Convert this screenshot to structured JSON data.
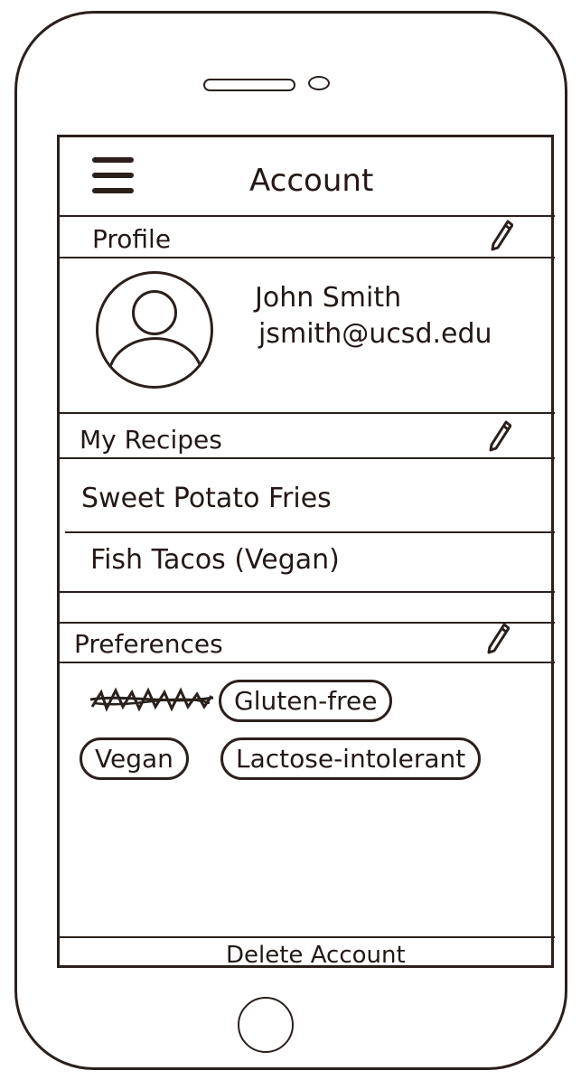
{
  "header": {
    "title": "Account",
    "menu_icon": "hamburger-menu-icon"
  },
  "profile": {
    "section_label": "Profile",
    "edit_icon": "pencil-icon",
    "avatar_icon": "user-avatar-icon",
    "name": "John Smith",
    "email": "jsmith@ucsd.edu"
  },
  "recipes": {
    "section_label": "My Recipes",
    "edit_icon": "pencil-icon",
    "items": [
      {
        "label": "Sweet Potato Fries"
      },
      {
        "label": "Fish Tacos (Vegan)"
      }
    ]
  },
  "preferences": {
    "section_label": "Preferences",
    "edit_icon": "pencil-icon",
    "tags": [
      {
        "label": "Gluten-free"
      },
      {
        "label": "Vegan"
      },
      {
        "label": "Lactose-intolerant"
      }
    ]
  },
  "footer": {
    "delete_label": "Delete Account"
  }
}
